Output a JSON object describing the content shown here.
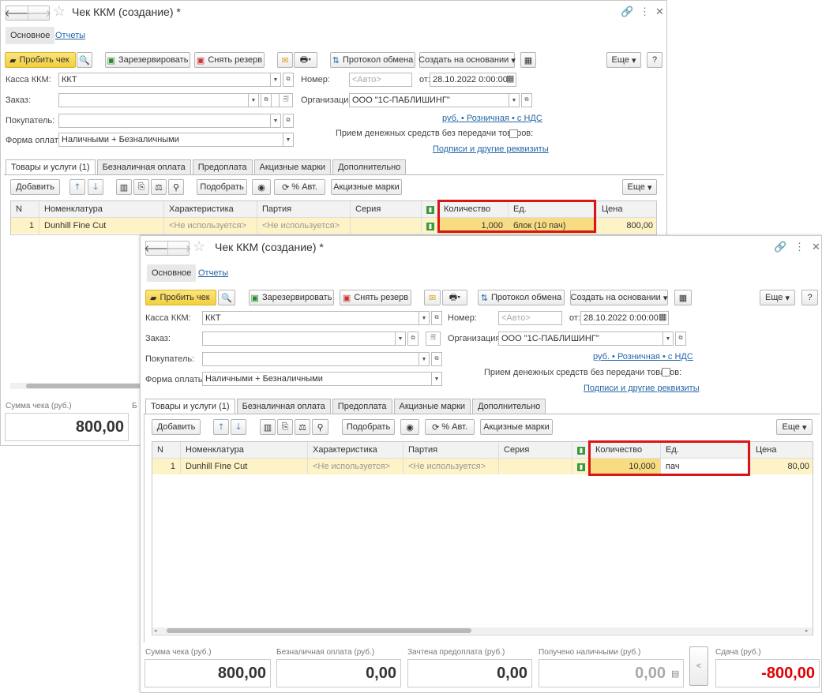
{
  "window": {
    "title": "Чек ККМ (создание) *",
    "tabs": {
      "main": "Основное",
      "reports": "Отчеты"
    }
  },
  "toolbar": {
    "punch": "Пробить чек",
    "reserve": "Зарезервировать",
    "unreserve": "Снять резерв",
    "protocol": "Протокол обмена",
    "create_based": "Создать на основании",
    "more": "Еще",
    "help": "?"
  },
  "form": {
    "kkm_label": "Касса ККМ:",
    "kkm_value": "ККТ",
    "number_label": "Номер:",
    "number_placeholder": "<Авто>",
    "date_label": "от:",
    "date_value": "28.10.2022  0:00:00",
    "order_label": "Заказ:",
    "org_label": "Организация:",
    "org_value": "ООО \"1С-ПАБЛИШИНГ\"",
    "buyer_label": "Покупатель:",
    "price_link": "руб. • Розничная • с НДС",
    "payment_label": "Форма оплаты:",
    "payment_value": "Наличными + Безналичными",
    "cash_no_goods": "Прием денежных средств без передачи товаров:",
    "signatures_link": "Подписи и другие реквизиты"
  },
  "tabs": [
    "Товары и услуги (1)",
    "Безналичная оплата",
    "Предоплата",
    "Акцизные марки",
    "Дополнительно"
  ],
  "table_toolbar": {
    "add": "Добавить",
    "pick": "Подобрать",
    "percent": "% Авт.",
    "excise": "Акцизные марки",
    "more": "Еще"
  },
  "grid": {
    "columns": [
      "N",
      "Номенклатура",
      "Характеристика",
      "Партия",
      "Серия",
      "Количество",
      "Ед.",
      "Цена"
    ]
  },
  "back": {
    "row": {
      "n": "1",
      "item": "Dunhill Fine Cut",
      "char": "<Не используется>",
      "batch": "<Не используется>",
      "series": "",
      "qty": "1,000",
      "unit": "блок (10 пач)",
      "price": "800,00"
    },
    "total_label": "Сумма чека (руб.)",
    "total": "800,00",
    "b_label_partial": "Б"
  },
  "front": {
    "row": {
      "n": "1",
      "item": "Dunhill Fine Cut",
      "char": "<Не используется>",
      "batch": "<Не используется>",
      "series": "",
      "qty": "10,000",
      "unit": "пач",
      "price": "80,00"
    },
    "totals": {
      "sum_label": "Сумма чека (руб.)",
      "sum": "800,00",
      "card_label": "Безналичная оплата (руб.)",
      "card": "0,00",
      "prepay_label": "Зачтена предоплата (руб.)",
      "prepay": "0,00",
      "cash_label": "Получено наличными (руб.)",
      "cash": "0,00",
      "change_label": "Сдача (руб.)",
      "change": "-800,00"
    }
  },
  "colors": {
    "accent": "#2466a8",
    "highlight": "#d91515",
    "yellow_row": "#fdf3c7",
    "negative": "#e10000"
  }
}
